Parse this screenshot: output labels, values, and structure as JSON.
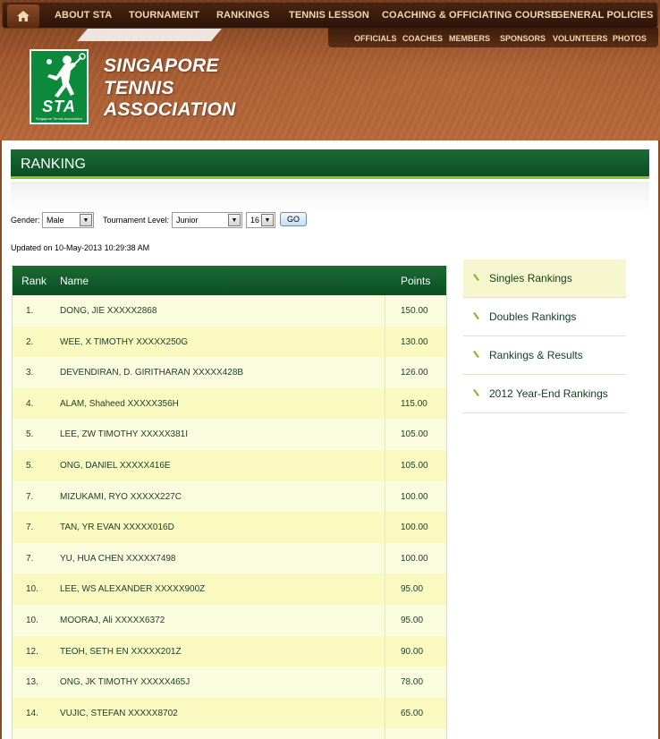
{
  "nav": {
    "items": [
      "ABOUT STA",
      "TOURNAMENT",
      "RANKINGS",
      "TENNIS LESSON",
      "COACHING & OFFICIATING COURSE",
      "GENERAL POLICIES"
    ],
    "subitems": [
      "OFFICIALS",
      "COACHES",
      "MEMBERS",
      "SPONSORS",
      "VOLUNTEERS",
      "PHOTOS"
    ],
    "home_icon": "home-icon"
  },
  "brand": {
    "logo_text": "STA",
    "logo_subtext": "Singapore Tennis Association",
    "line1": "SINGAPORE",
    "line2": "TENNIS",
    "line3": "ASSOCIATION"
  },
  "page": {
    "title": "RANKING"
  },
  "filters": {
    "gender_label": "Gender:",
    "gender_value": "Male",
    "level_label": "Tournament Level:",
    "level_value": "Junior",
    "age_value": "16",
    "go_label": "GO"
  },
  "updated": "Updated on 10-May-2013 10:29:38 AM",
  "table": {
    "headers": {
      "rank": "Rank",
      "name": "Name",
      "points": "Points"
    },
    "rows": [
      {
        "rank": "1.",
        "name": "DONG, JIE XXXXX2868",
        "points": "150.00"
      },
      {
        "rank": "2.",
        "name": "WEE, X TIMOTHY XXXXX250G",
        "points": "130.00"
      },
      {
        "rank": "3.",
        "name": "DEVENDIRAN, D. GIRITHARAN XXXXX428B",
        "points": "126.00"
      },
      {
        "rank": "4.",
        "name": "ALAM, Shaheed XXXXX356H",
        "points": "115.00"
      },
      {
        "rank": "5.",
        "name": "LEE, ZW TIMOTHY XXXXX381I",
        "points": "105.00"
      },
      {
        "rank": "5.",
        "name": "ONG, DANIEL XXXXX416E",
        "points": "105.00"
      },
      {
        "rank": "7.",
        "name": "MIZUKAMI, RYO XXXXX227C",
        "points": "100.00"
      },
      {
        "rank": "7.",
        "name": "TAN, YR EVAN XXXXX016D",
        "points": "100.00"
      },
      {
        "rank": "7.",
        "name": "YU, HUA CHEN XXXXX7498",
        "points": "100.00"
      },
      {
        "rank": "10.",
        "name": "LEE, WS ALEXANDER XXXXX900Z",
        "points": "95.00"
      },
      {
        "rank": "10.",
        "name": "MOORAJ, Ali XXXXX6372",
        "points": "95.00"
      },
      {
        "rank": "12.",
        "name": "TEOH, SETH EN XXXXX201Z",
        "points": "90.00"
      },
      {
        "rank": "13.",
        "name": "ONG, JK TIMOTHY XXXXX465J",
        "points": "78.00"
      },
      {
        "rank": "14.",
        "name": "VUJIC, STEFAN XXXXX8702",
        "points": "65.00"
      },
      {
        "rank": "",
        "name": "",
        "points": ""
      }
    ]
  },
  "side_menu": [
    {
      "label": "Singles Rankings",
      "active": true
    },
    {
      "label": "Doubles Rankings",
      "active": false
    },
    {
      "label": "Rankings & Results",
      "active": false
    },
    {
      "label": "2012 Year-End Rankings",
      "active": false
    }
  ],
  "colors": {
    "header_brown": "#a4592f",
    "green_bar": "#0b4f22",
    "accent_lime": "#93c02a",
    "row_odd": "#fbfcde",
    "row_even": "#fafac0",
    "logo_green": "#0b8a3c"
  }
}
